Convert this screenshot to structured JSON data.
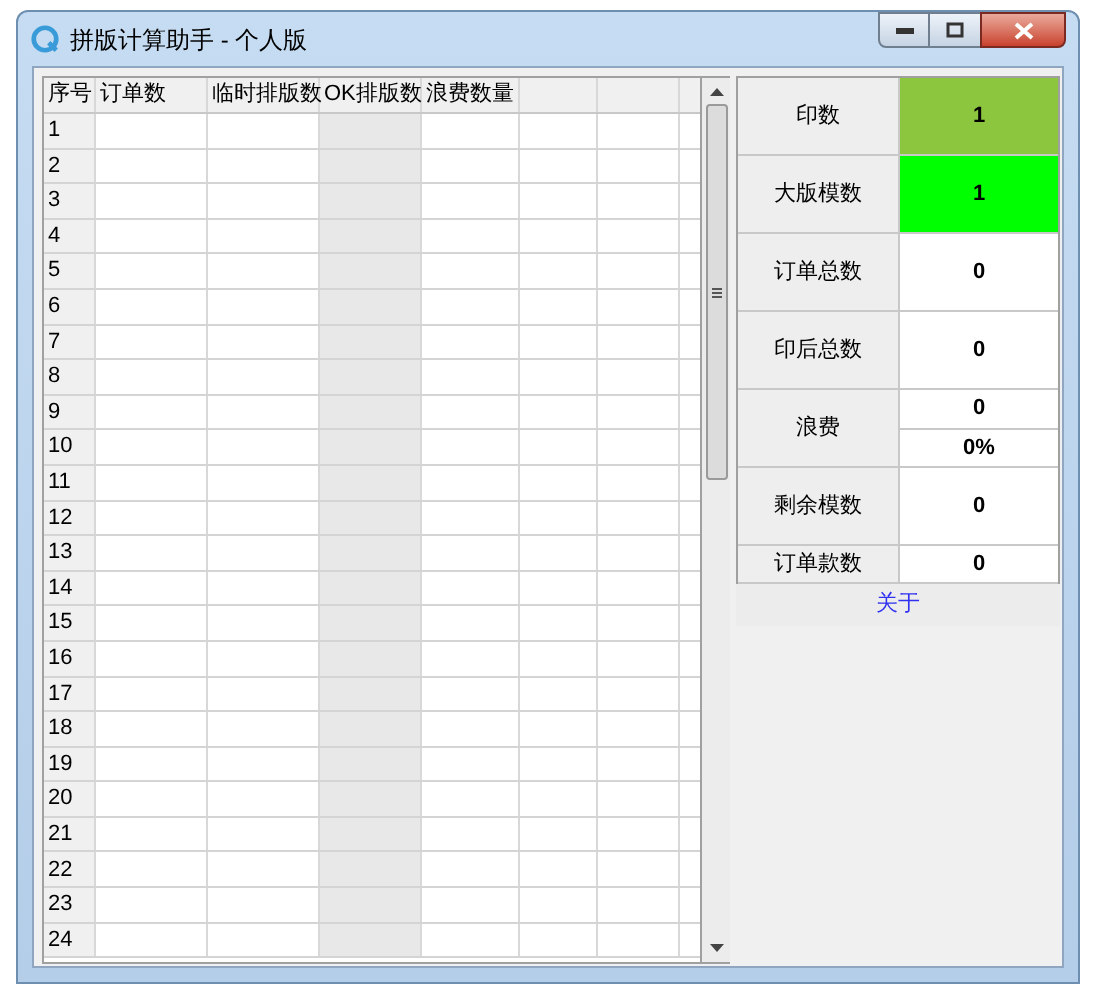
{
  "window": {
    "title": "拼版计算助手 - 个人版"
  },
  "table": {
    "columns": [
      {
        "label": "序号",
        "shaded": false
      },
      {
        "label": "订单数",
        "shaded": false
      },
      {
        "label": "临时排版数",
        "shaded": false
      },
      {
        "label": "OK排版数",
        "shaded": true
      },
      {
        "label": "浪费数量",
        "shaded": false
      },
      {
        "shaded": false
      },
      {
        "shaded": false
      }
    ],
    "rows": [
      "1",
      "2",
      "3",
      "4",
      "5",
      "6",
      "7",
      "8",
      "9",
      "10",
      "11",
      "12",
      "13",
      "14",
      "15",
      "16",
      "17",
      "18",
      "19",
      "20",
      "21",
      "22",
      "23",
      "24"
    ]
  },
  "stats": [
    {
      "kind": "single",
      "label": "印数",
      "values": [
        "1"
      ],
      "color": "#8cc63f"
    },
    {
      "kind": "single",
      "label": "大版模数",
      "values": [
        "1"
      ],
      "color": "#00ff00"
    },
    {
      "kind": "single",
      "label": "订单总数",
      "values": [
        "0"
      ],
      "color": "#ffffff"
    },
    {
      "kind": "single",
      "label": "印后总数",
      "values": [
        "0"
      ],
      "color": "#ffffff"
    },
    {
      "kind": "split",
      "label": "浪费",
      "values": [
        "0",
        "0%"
      ],
      "color": "#ffffff"
    },
    {
      "kind": "single",
      "label": "剩余模数",
      "values": [
        "0"
      ],
      "color": "#ffffff"
    },
    {
      "kind": "short",
      "label": "订单款数",
      "values": [
        "0"
      ],
      "color": "#ffffff"
    }
  ],
  "about_button": "关于"
}
